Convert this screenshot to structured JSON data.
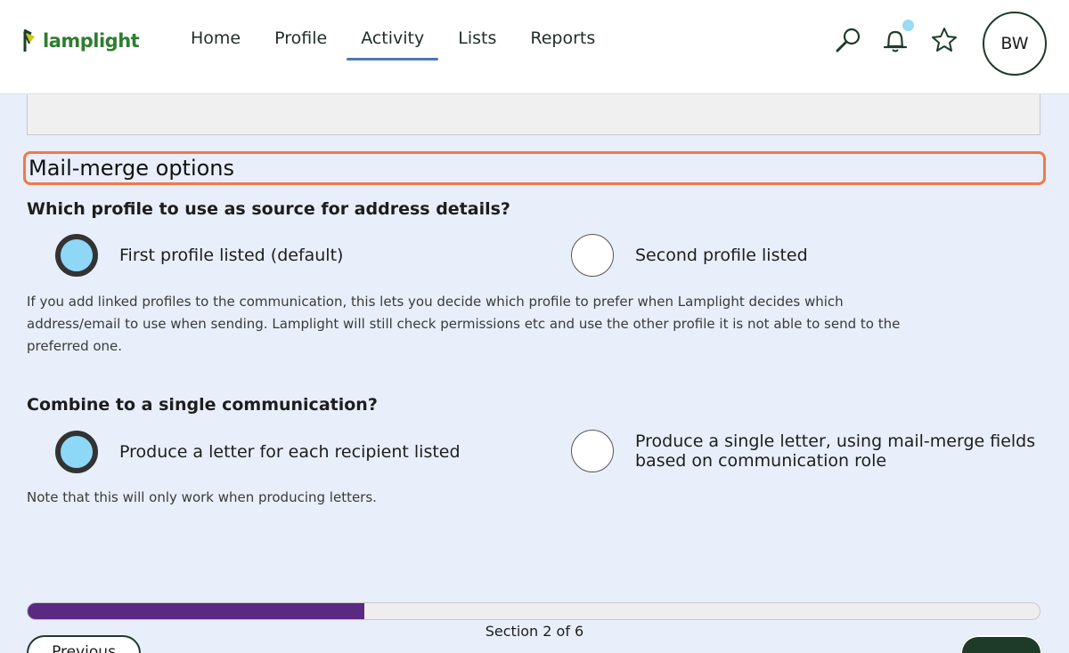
{
  "app": {
    "logo_text": "lamplight"
  },
  "nav": {
    "items": [
      {
        "label": "Home"
      },
      {
        "label": "Profile"
      },
      {
        "label": "Activity"
      },
      {
        "label": "Lists"
      },
      {
        "label": "Reports"
      }
    ],
    "active": "Activity"
  },
  "header_icons": [
    "search-icon",
    "bell-icon",
    "star-icon"
  ],
  "user": {
    "initials": "BW"
  },
  "section": {
    "title": "Mail-merge options"
  },
  "q1": {
    "question": "Which profile to use as source for address details?",
    "options": [
      {
        "label": "First profile listed (default)",
        "checked": true
      },
      {
        "label": "Second profile listed",
        "checked": false
      }
    ],
    "help_lines": [
      "If you add linked profiles to the communication, this lets you decide which profile to prefer when Lamplight decides which",
      "address/email to use when sending. Lamplight will still check permissions etc and use the other profile it is not able to send to the",
      "preferred one."
    ]
  },
  "q2": {
    "question": "Combine to a single communication?",
    "options": [
      {
        "label": "Produce a letter for each recipient listed",
        "checked": true
      },
      {
        "label_line1": "Produce a single letter, using mail-merge fields",
        "label_line2": "based on communication role",
        "checked": false
      }
    ],
    "help": "Note that this will only work when producing letters."
  },
  "progress": {
    "text": "Section 2 of 6",
    "fraction": 0.333
  },
  "buttons": {
    "previous": "Previous"
  },
  "colors": {
    "accent": "#f2784b",
    "progress": "#5a2a82",
    "radio_fill": "#8fd7f7",
    "nav_underline": "#4a78b4",
    "brand_green": "#2f7d32"
  }
}
